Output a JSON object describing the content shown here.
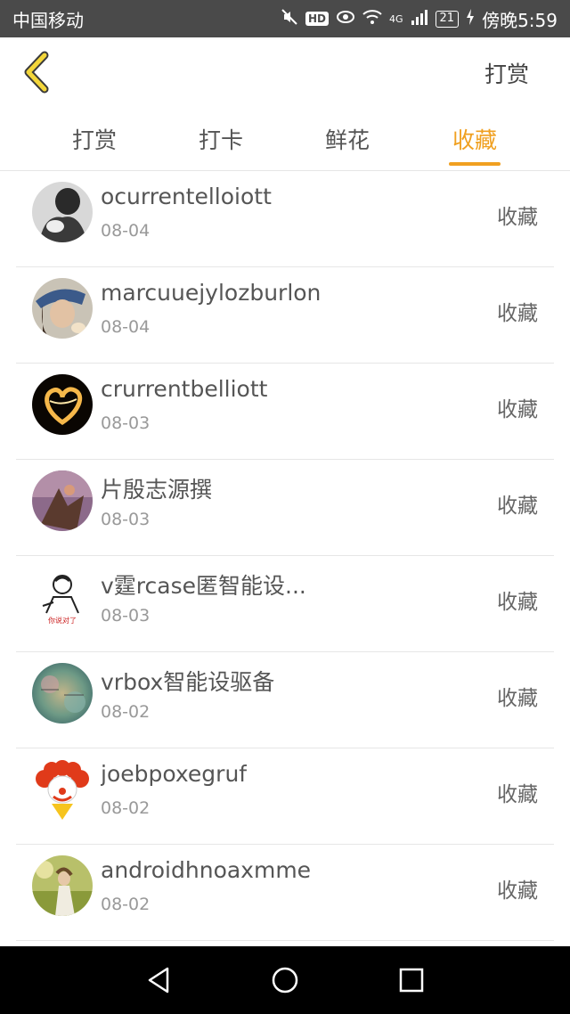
{
  "status_bar": {
    "carrier": "中国移动",
    "network": "4G",
    "battery": "21",
    "time": "傍晚5:59",
    "hd_label": "HD"
  },
  "header": {
    "action_label": "打赏"
  },
  "tabs": [
    {
      "label": "打赏",
      "active": false
    },
    {
      "label": "打卡",
      "active": false
    },
    {
      "label": "鲜花",
      "active": false
    },
    {
      "label": "收藏",
      "active": true
    }
  ],
  "colors": {
    "accent": "#f0a020",
    "status_bar": "#4a4a4a",
    "nav_bar": "#000000"
  },
  "list": [
    {
      "name": "ocurrentelloiott",
      "date": "08-04",
      "action": "收藏",
      "avatar": "grayscale-portrait"
    },
    {
      "name": "marcuuejylozburlon",
      "date": "08-04",
      "action": "收藏",
      "avatar": "hat-portrait"
    },
    {
      "name": "crurrentbelliott",
      "date": "08-03",
      "action": "收藏",
      "avatar": "glowing-heart"
    },
    {
      "name": "片殷志源撰",
      "date": "08-03",
      "action": "收藏",
      "avatar": "fantasy-art"
    },
    {
      "name": "v霆rcase匿智能设...",
      "date": "08-03",
      "action": "收藏",
      "avatar": "cartoon-sketch",
      "avatar_caption": "你说对了"
    },
    {
      "name": "vrbox智能设驱备",
      "date": "08-02",
      "action": "收藏",
      "avatar": "watercolor-text"
    },
    {
      "name": "joebpoxegruf",
      "date": "08-02",
      "action": "收藏",
      "avatar": "clown"
    },
    {
      "name": "androidhnoaxmme",
      "date": "08-02",
      "action": "收藏",
      "avatar": "nature-portrait"
    }
  ],
  "nav_bar": {
    "buttons": [
      "back-triangle",
      "home-circle",
      "recents-square"
    ]
  }
}
